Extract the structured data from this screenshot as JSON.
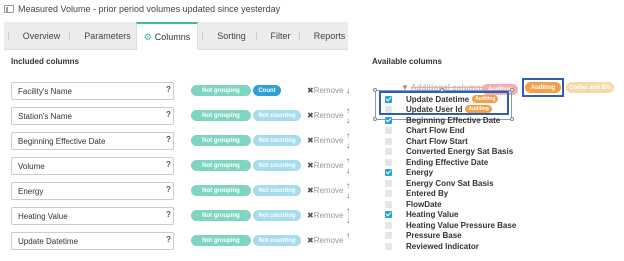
{
  "header": {
    "title": "Measured Volume - prior period volumes updated since yesterday"
  },
  "tabs": [
    {
      "label": "Overview",
      "active": false
    },
    {
      "label": "Parameters",
      "active": false
    },
    {
      "label": "Columns",
      "active": true
    },
    {
      "label": "Sorting",
      "active": false
    },
    {
      "label": "Filter",
      "active": false
    },
    {
      "label": "Reports",
      "active": false
    }
  ],
  "included": {
    "heading": "Included columns",
    "rows": [
      {
        "name": "Facility's Name",
        "q": "?",
        "grouping": "Not grouping",
        "counting": "Count",
        "remove": "Remove"
      },
      {
        "name": "Station's Name",
        "q": "?",
        "grouping": "Not grouping",
        "counting": "Not counting",
        "remove": "Remove"
      },
      {
        "name": "Beginning Effective Date",
        "q": "?",
        "grouping": "Not grouping",
        "counting": "Not counting",
        "remove": "Remove"
      },
      {
        "name": "Volume",
        "q": "?",
        "grouping": "Not grouping",
        "counting": "Not counting",
        "remove": "Remove"
      },
      {
        "name": "Energy",
        "q": "?",
        "grouping": "Not grouping",
        "counting": "Not counting",
        "remove": "Remove"
      },
      {
        "name": "Heating Value",
        "q": "?",
        "grouping": "Not grouping",
        "counting": "Not counting",
        "remove": "Remove"
      },
      {
        "name": "Update Datetime",
        "q": "?",
        "grouping": "Not grouping",
        "counting": "Not counting",
        "remove": "Remove"
      }
    ]
  },
  "available": {
    "heading": "Available columns",
    "group_header": "Additional columns",
    "tags": {
      "collapsed": "Auditing",
      "auditing": "Auditing",
      "codes": "Codes and IDs"
    },
    "items": [
      {
        "label": "Update Datetime",
        "checked": true,
        "badge": "Auditing"
      },
      {
        "label": "Update User Id",
        "checked": false,
        "badge": "Auditing"
      },
      {
        "label": "Beginning Effective Date",
        "checked": true,
        "badge": ""
      },
      {
        "label": "Chart Flow End",
        "checked": false,
        "badge": ""
      },
      {
        "label": "Chart Flow Start",
        "checked": false,
        "badge": ""
      },
      {
        "label": "Converted Energy Sat Basis",
        "checked": false,
        "badge": ""
      },
      {
        "label": "Ending Effective Date",
        "checked": false,
        "badge": ""
      },
      {
        "label": "Energy",
        "checked": true,
        "badge": ""
      },
      {
        "label": "Energy Conv Sat Basis",
        "checked": false,
        "badge": ""
      },
      {
        "label": "Entered By",
        "checked": false,
        "badge": ""
      },
      {
        "label": "FlowDate",
        "checked": false,
        "badge": ""
      },
      {
        "label": "Heating Value",
        "checked": true,
        "badge": ""
      },
      {
        "label": "Heating Value Pressure Base",
        "checked": false,
        "badge": ""
      },
      {
        "label": "Pressure Base",
        "checked": false,
        "badge": ""
      },
      {
        "label": "Reviewed Indicator",
        "checked": false,
        "badge": ""
      }
    ]
  },
  "colors": {
    "accent": "#3bbf9f",
    "count_active": "#2f9fd6",
    "auditing": "#f0a14a",
    "highlight": "#2f5fae"
  },
  "icons": {
    "header": "report-icon",
    "columns_tab": "columns-icon",
    "remove": "close-icon",
    "up": "arrow-up-icon",
    "down": "arrow-down-icon"
  }
}
